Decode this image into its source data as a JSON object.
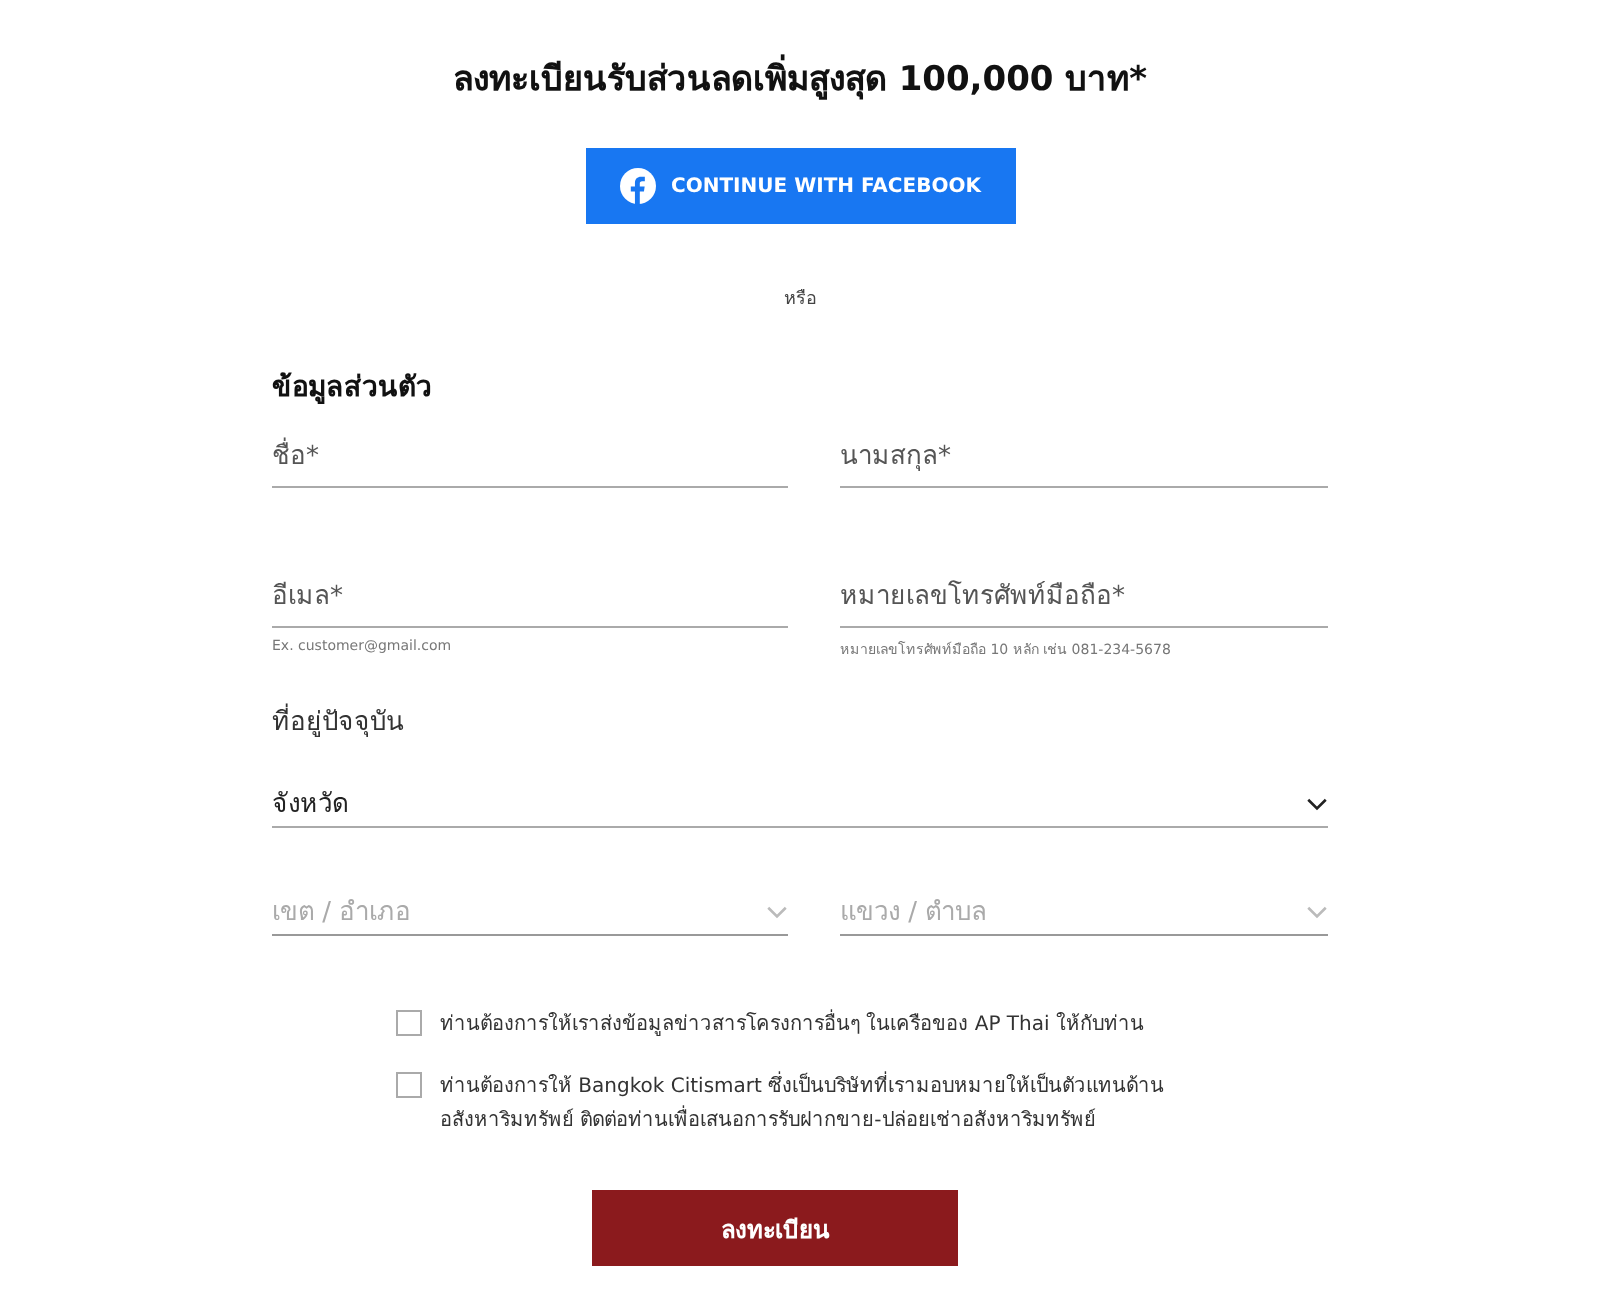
{
  "title": "ลงทะเบียนรับส่วนลดเพิ่มสูงสุด 100,000 บาท*",
  "facebook_button": {
    "label": "CONTINUE WITH FACEBOOK"
  },
  "divider_text": "หรือ",
  "personal_section": {
    "heading": "ข้อมูลส่วนตัว",
    "fields": [
      {
        "placeholder": "ชื่อ*"
      },
      {
        "placeholder": "นามสกุล*"
      },
      {
        "placeholder": "อีเมล*",
        "hint": "Ex. customer@gmail.com"
      },
      {
        "placeholder": "หมายเลขโทรศัพท์มือถือ*",
        "hint": "หมายเลขโทรศัพท์มือถือ 10 หลัก เช่น 081-234-5678"
      }
    ]
  },
  "address_section": {
    "heading": "ที่อยู่ปัจจุบัน",
    "selects": [
      {
        "placeholder": "จังหวัด",
        "disabled": false
      },
      {
        "placeholder": "เขต / อำเภอ",
        "disabled": true
      },
      {
        "placeholder": "แขวง / ตำบล",
        "disabled": true
      }
    ]
  },
  "consents": [
    {
      "label": "ท่านต้องการให้เราส่งข้อมูลข่าวสารโครงการอื่นๆ ในเครือของ AP Thai ให้กับท่าน",
      "checked": false
    },
    {
      "label": "ท่านต้องการให้ Bangkok Citismart ซึ่งเป็นบริษัทที่เรามอบหมายให้เป็นตัวแทนด้านอสังหาริมทรัพย์ ติดต่อท่านเพื่อเสนอการรับฝากขาย-ปล่อยเช่าอสังหาริมทรัพย์",
      "checked": false
    }
  ],
  "submit_button": {
    "label": "ลงทะเบียน"
  }
}
